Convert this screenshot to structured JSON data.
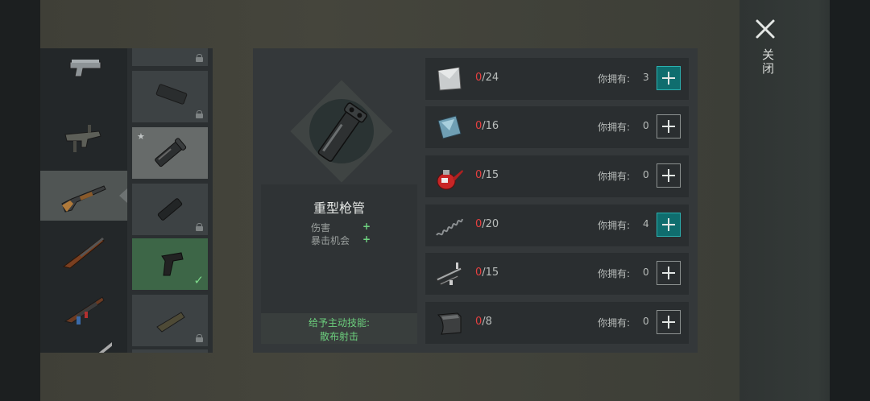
{
  "close": {
    "label": "关闭",
    "icon": "close-icon"
  },
  "weapons": [
    {
      "name": "pistol",
      "icon": "pistol-icon"
    },
    {
      "name": "uzi",
      "icon": "uzi-icon"
    },
    {
      "name": "shotgun",
      "icon": "shotgun-icon",
      "selected": true
    },
    {
      "name": "hunting-rifle",
      "icon": "hunting-rifle-icon"
    },
    {
      "name": "ak",
      "icon": "ak-icon"
    },
    {
      "name": "sniper",
      "icon": "sniper-icon"
    }
  ],
  "parts": [
    {
      "icon": "part-icon",
      "locked": true
    },
    {
      "icon": "magazine-part-icon",
      "locked": true
    },
    {
      "icon": "heavy-barrel-part-icon",
      "highlighted": true,
      "starred": true
    },
    {
      "icon": "barrel-part-icon",
      "locked": true
    },
    {
      "icon": "grip-part-icon",
      "equipped": true
    },
    {
      "icon": "stock-part-icon",
      "locked": true
    }
  ],
  "detail": {
    "name": "重型枪管",
    "stats": [
      {
        "label": "伤害",
        "sign": "+"
      },
      {
        "label": "暴击机会",
        "sign": "+"
      }
    ],
    "skill_title": "给予主动技能:",
    "skill_name": "散布射击"
  },
  "materials": [
    {
      "icon": "metal-plate-icon",
      "have": "0",
      "need": "/24",
      "owned_label": "你拥有:",
      "owned": "3",
      "addable": true
    },
    {
      "icon": "glass-plate-icon",
      "have": "0",
      "need": "/16",
      "owned_label": "你拥有:",
      "owned": "0",
      "addable": false
    },
    {
      "icon": "oil-can-icon",
      "have": "0",
      "need": "/15",
      "owned_label": "你拥有:",
      "owned": "0",
      "addable": false
    },
    {
      "icon": "spring-icon",
      "have": "0",
      "need": "/20",
      "owned_label": "你拥有:",
      "owned": "4",
      "addable": true
    },
    {
      "icon": "gun-parts-icon",
      "have": "0",
      "need": "/15",
      "owned_label": "你拥有:",
      "owned": "0",
      "addable": false
    },
    {
      "icon": "bent-sheet-icon",
      "have": "0",
      "need": "/8",
      "owned_label": "你拥有:",
      "owned": "0",
      "addable": false
    }
  ],
  "colors": {
    "accent": "#0f6d6e",
    "missing": "#e64040",
    "positive": "#6fd481"
  }
}
